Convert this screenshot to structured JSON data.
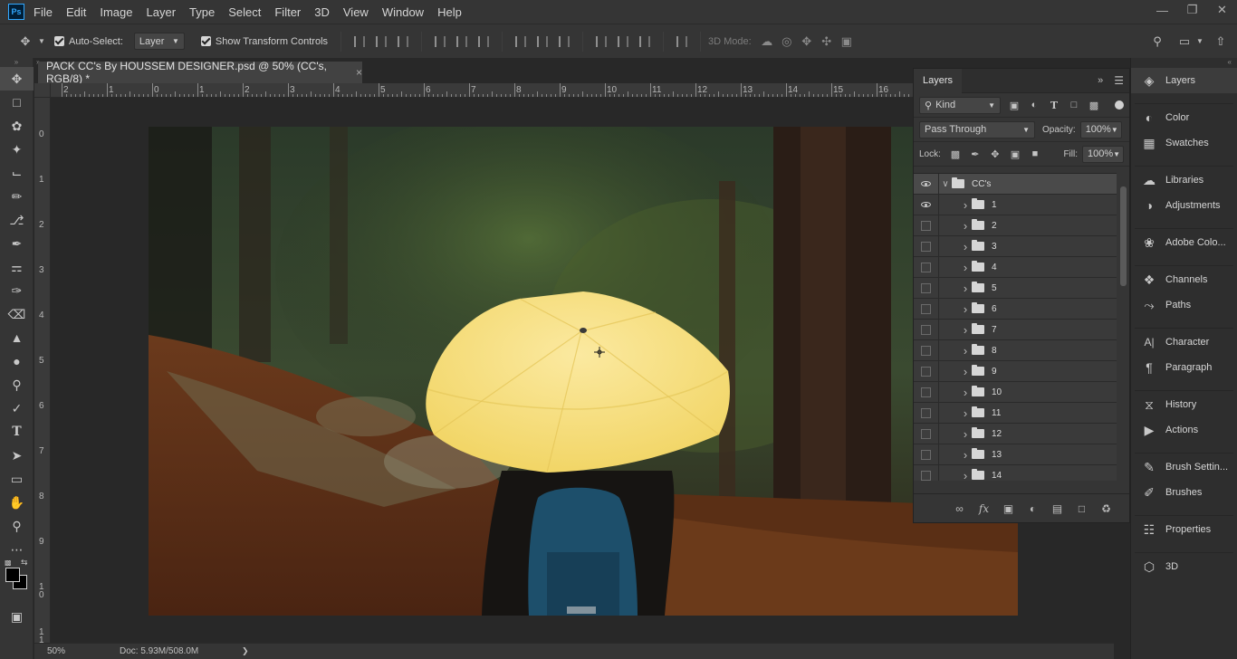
{
  "app": {
    "logo": "Ps"
  },
  "menu": [
    "File",
    "Edit",
    "Image",
    "Layer",
    "Type",
    "Select",
    "Filter",
    "3D",
    "View",
    "Window",
    "Help"
  ],
  "options": {
    "auto_select_label": "Auto-Select:",
    "auto_select_value": "Layer",
    "transform_label": "Show Transform Controls",
    "mode_3d_label": "3D Mode:"
  },
  "document": {
    "tab_title": "PACK CC's By HOUSSEM DESIGNER.psd @ 50% (CC's, RGB/8) *",
    "close": "×"
  },
  "rulers": {
    "h": [
      "2",
      "1",
      "0",
      "1",
      "2",
      "3",
      "4",
      "5",
      "6",
      "7",
      "8",
      "9",
      "10",
      "11",
      "12",
      "13",
      "14",
      "15",
      "16"
    ],
    "v": [
      "0",
      "1",
      "2",
      "3",
      "4",
      "5",
      "6",
      "7",
      "8",
      "9",
      "1\n0",
      "1\n1"
    ]
  },
  "status": {
    "zoom": "50%",
    "doc": "Doc: 5.93M/508.0M",
    "arrow": "❯"
  },
  "layers_panel": {
    "tab": "Layers",
    "filter_kind": "Kind",
    "blend_mode": "Pass Through",
    "opacity_label": "Opacity:",
    "opacity_value": "100%",
    "lock_label": "Lock:",
    "fill_label": "Fill:",
    "fill_value": "100%",
    "group": {
      "name": "CC's",
      "visible": true
    },
    "layers": [
      {
        "name": "1",
        "visible": true
      },
      {
        "name": "2",
        "visible": false
      },
      {
        "name": "3",
        "visible": false
      },
      {
        "name": "4",
        "visible": false
      },
      {
        "name": "5",
        "visible": false
      },
      {
        "name": "6",
        "visible": false
      },
      {
        "name": "7",
        "visible": false
      },
      {
        "name": "8",
        "visible": false
      },
      {
        "name": "9",
        "visible": false
      },
      {
        "name": "10",
        "visible": false
      },
      {
        "name": "11",
        "visible": false
      },
      {
        "name": "12",
        "visible": false
      },
      {
        "name": "13",
        "visible": false
      },
      {
        "name": "14",
        "visible": false
      }
    ]
  },
  "dock": [
    {
      "label": "Layers",
      "icon": "layers-icon",
      "active": true
    },
    {
      "label": "Color",
      "icon": "color-icon"
    },
    {
      "label": "Swatches",
      "icon": "swatches-icon"
    },
    {
      "label": "Libraries",
      "icon": "libraries-icon"
    },
    {
      "label": "Adjustments",
      "icon": "adjustments-icon"
    },
    {
      "label": "Adobe Colo...",
      "icon": "adobe-color-icon"
    },
    {
      "label": "Channels",
      "icon": "channels-icon"
    },
    {
      "label": "Paths",
      "icon": "paths-icon"
    },
    {
      "label": "Character",
      "icon": "character-icon"
    },
    {
      "label": "Paragraph",
      "icon": "paragraph-icon"
    },
    {
      "label": "History",
      "icon": "history-icon"
    },
    {
      "label": "Actions",
      "icon": "actions-icon"
    },
    {
      "label": "Brush Settin...",
      "icon": "brush-settings-icon"
    },
    {
      "label": "Brushes",
      "icon": "brushes-icon"
    },
    {
      "label": "Properties",
      "icon": "properties-icon"
    },
    {
      "label": "3D",
      "icon": "3d-icon"
    }
  ],
  "colors": {
    "accent": "#31a8ff",
    "panel": "#353535",
    "umbrella": "#f5df7a",
    "backpack": "#1d4f6b"
  }
}
